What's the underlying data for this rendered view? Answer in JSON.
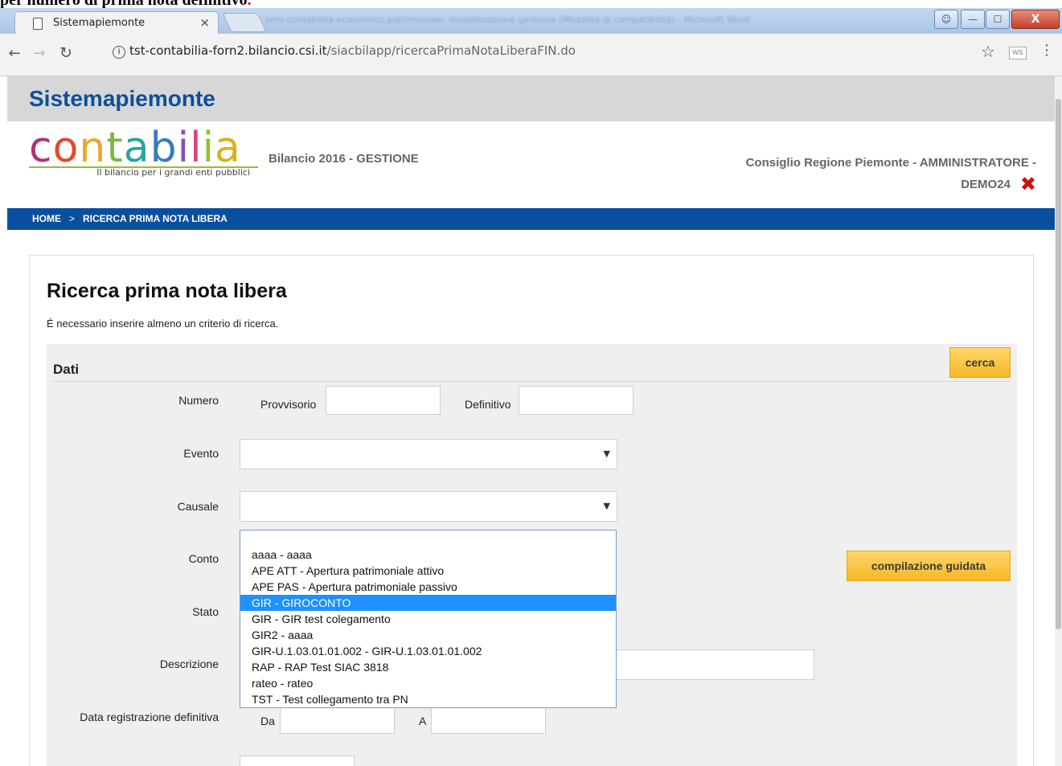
{
  "doc_caption": {
    "text": "per numero di prima nota definitivo",
    "accent": "."
  },
  "browser": {
    "tab_title": "Sistemapiemonte",
    "tab_close": "×",
    "other_window_title": "sem contabilità economico patrimoniale: inizializzazione gestione (Modalità di compatibilità) - Microsoft Word",
    "url_host": "tst-contabilia-forn2.bilancio.csi.it",
    "url_path": "/siacbilapp/ricercaPrimaNotaLiberaFIN.do",
    "ext_label": "WS"
  },
  "site": {
    "header_title": "Sistemapiemonte",
    "logo_text": "contabilia",
    "logo_tagline": "Il bilancio per i grandi enti pubblici",
    "bilancio": "Bilancio 2016 - GESTIONE",
    "user_line1": "Consiglio Regione Piemonte - AMMINISTRATORE -",
    "user_line2": "DEMO24"
  },
  "breadcrumb": {
    "home": "HOME",
    "sep": ">",
    "current": "RICERCA PRIMA NOTA LIBERA"
  },
  "main": {
    "title": "Ricerca prima nota libera",
    "note": "É necessario inserire almeno un criterio di ricerca."
  },
  "form": {
    "section_title": "Dati",
    "cerca_label": "cerca",
    "compilazione_label": "compilazione guidata",
    "labels": {
      "numero": "Numero",
      "provvisorio": "Provvisorio",
      "definitivo": "Definitivo",
      "evento": "Evento",
      "causale": "Causale",
      "conto": "Conto",
      "stato": "Stato",
      "descrizione": "Descrizione",
      "data_reg": "Data registrazione definitiva",
      "da": "Da",
      "a": "A"
    },
    "causale_options": [
      "aaaa - aaaa",
      "APE ATT - Apertura patrimoniale attivo",
      "APE PAS - Apertura patrimoniale passivo",
      "GIR - GIROCONTO",
      "GIR - GIR test colegamento",
      "GIR2 - aaaa",
      "GIR-U.1.03.01.01.002 - GIR-U.1.03.01.01.002",
      "RAP - RAP Test SIAC 3818",
      "rateo - rateo",
      "TST - Test collegamento tra PN"
    ],
    "causale_highlighted": "GIR - GIROCONTO"
  },
  "colors": {
    "brand_blue": "#0b4f9c",
    "button_yellow": "#f5b825",
    "highlight": "#1e90ff"
  }
}
